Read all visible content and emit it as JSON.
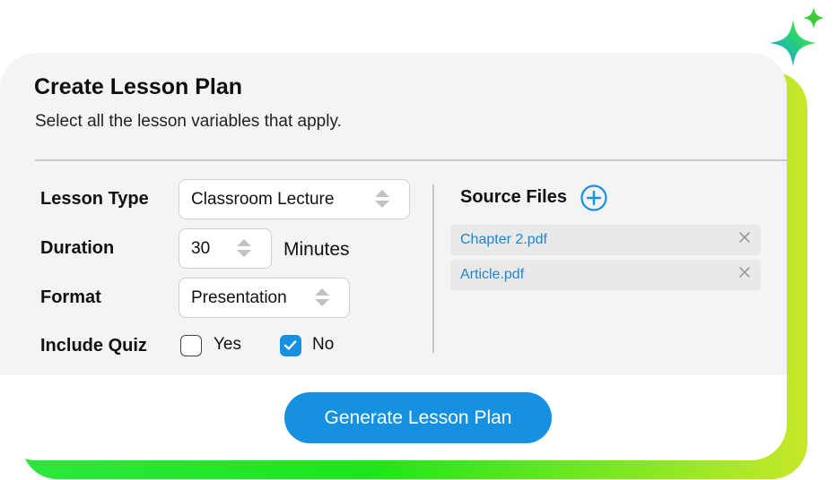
{
  "header": {
    "title": "Create Lesson Plan",
    "subtitle": "Select all the lesson variables that apply."
  },
  "form": {
    "lesson_type": {
      "label": "Lesson Type",
      "value": "Classroom Lecture"
    },
    "duration": {
      "label": "Duration",
      "value": "30",
      "unit": "Minutes"
    },
    "format": {
      "label": "Format",
      "value": "Presentation"
    },
    "include_quiz": {
      "label": "Include Quiz",
      "options": [
        {
          "label": "Yes",
          "checked": false
        },
        {
          "label": "No",
          "checked": true
        }
      ]
    }
  },
  "source_files": {
    "title": "Source Files",
    "files": [
      {
        "name": "Chapter 2.pdf"
      },
      {
        "name": "Article.pdf"
      }
    ]
  },
  "actions": {
    "generate_label": "Generate Lesson Plan"
  },
  "colors": {
    "accent": "#1690e0",
    "link": "#1a87d6",
    "gradient_start": "#2ee63c",
    "gradient_end": "#c6e82a"
  },
  "icons": {
    "sparkle": "sparkle-icon",
    "add": "plus-circle-icon",
    "remove": "close-icon",
    "stepper": "up-down-arrows-icon",
    "check": "checkmark-icon"
  }
}
